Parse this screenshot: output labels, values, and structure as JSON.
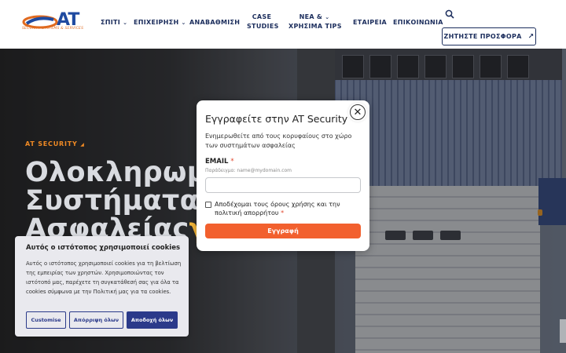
{
  "header": {
    "logo_text": "AT",
    "logo_subtitle": "SECURITY SYSTEMS & SERVICES",
    "nav": [
      {
        "label": "ΣΠΙΤΙ",
        "has_dropdown": true
      },
      {
        "label": "ΕΠΙΧΕΙΡΗΣΗ",
        "has_dropdown": true
      },
      {
        "label": "ΑΝΑΒΑΘΜΙΣΗ",
        "has_dropdown": false
      },
      {
        "label": "CASE",
        "label2": "STUDIES",
        "has_dropdown": false
      },
      {
        "label": "ΝΕΑ &",
        "label2": "ΧΡΗΣΙΜΑ TIPS",
        "has_dropdown": true
      },
      {
        "label": "ΕΤΑΙΡΕΙΑ",
        "has_dropdown": false
      },
      {
        "label": "ΕΠΙΚΟΙΝΩΝΙΑ",
        "has_dropdown": false
      }
    ],
    "chevron": "⌄",
    "offer_button": "ΖΗΤΗΣΤΕ ΠΡΟΣΦΟΡΑ",
    "offer_arrow": "↗"
  },
  "hero": {
    "tag": "AT SECURITY",
    "title_line1": "Ολοκληρωμ",
    "title_line2": "Συστήματα",
    "title_line3": "Ασφαλείας",
    "title_highlight": "γ"
  },
  "modal": {
    "title": "Εγγραφείτε στην AT Security",
    "description": "Ενημερωθείτε από τους κορυφαίους στο χώρο των συστημάτων ασφαλείας",
    "email_label": "EMAIL",
    "required_mark": "*",
    "email_hint": "Παράδειγμα: name@mydomain.com",
    "email_value": "",
    "terms_label": "Αποδέχομαι τους όρους χρήσης και την πολιτική απορρήτου",
    "submit_label": "Εγγραφή",
    "close_symbol": "✕"
  },
  "cookie": {
    "title": "Αυτός ο ιστότοπος χρησιμοποιεί cookies",
    "text": "Αυτός ο ιστότοπος χρησιμοποιεί cookies για τη βελτίωση της εμπειρίας των χρηστών. Χρησιμοποιώντας τον ιστότοπό μας, παρέχετε τη συγκατάθεσή σας για όλα τα cookies σύμφωνα με την Πολιτική μας για τα cookies.",
    "customise": "Customise",
    "reject": "Απόρριψη όλων",
    "accept": "Αποδοχή όλων"
  },
  "colors": {
    "brand_navy": "#1b2d5c",
    "accent_orange": "#f2602e",
    "cookie_blue": "#2b3a8a"
  }
}
